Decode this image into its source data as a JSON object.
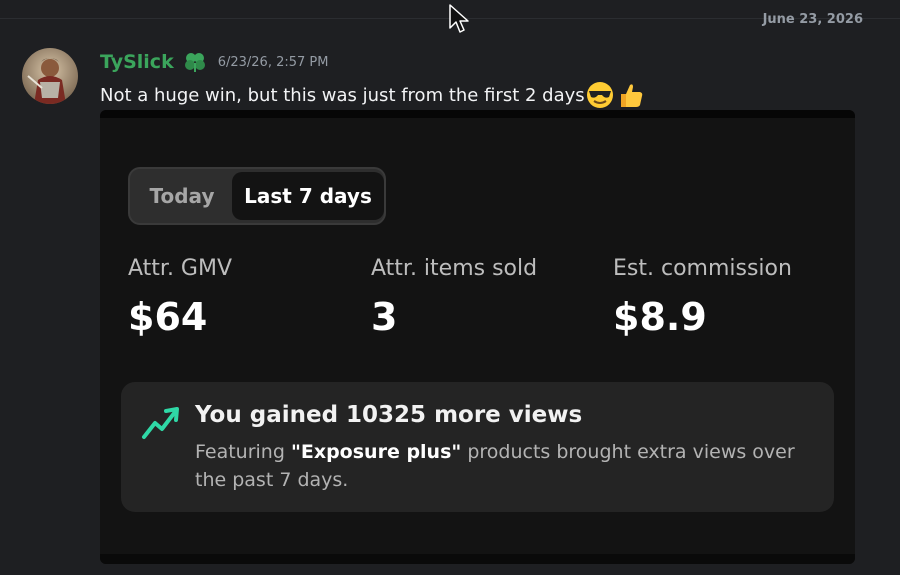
{
  "date_divider": "June 23, 2026",
  "message": {
    "username": "TySlick",
    "timestamp": "6/23/26, 2:57 PM",
    "text": "Not a huge win, but this was just from the first 2 days",
    "emojis": [
      "sunglasses-emoji",
      "thumbs-up-emoji"
    ]
  },
  "card": {
    "tabs": {
      "today": "Today",
      "last7": "Last 7 days",
      "selected": "Last 7 days"
    },
    "metrics": [
      {
        "label": "Attr. GMV",
        "value": "$64"
      },
      {
        "label": "Attr. items sold",
        "value": "3"
      },
      {
        "label": "Est. commission",
        "value": "$8.9"
      }
    ],
    "views": {
      "title": "You gained 10325 more views",
      "desc_prefix": "Featuring ",
      "desc_highlight": "\"Exposure plus\"",
      "desc_suffix": " products brought extra views over the past 7 days."
    }
  },
  "colors": {
    "username": "#3ba55c",
    "trend_icon": "#2fd8a6",
    "card_bg": "#131313"
  }
}
